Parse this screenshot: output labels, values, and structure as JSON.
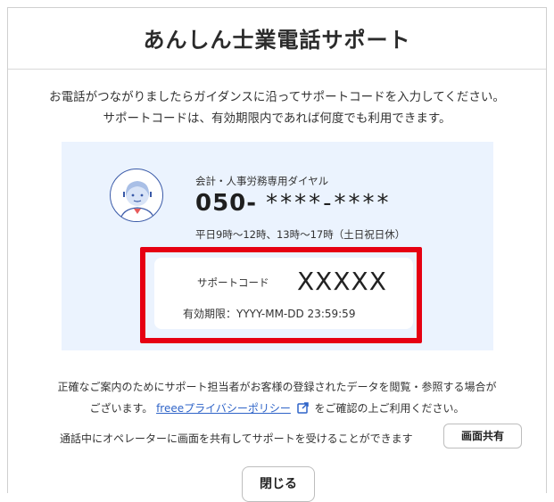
{
  "dialog": {
    "title": "あんしん士業電話サポート",
    "description_line1": "お電話がつながりましたらガイダンスに沿ってサポートコードを入力してください。",
    "description_line2": "サポートコードは、有効期限内であれば何度でも利用できます。"
  },
  "dial": {
    "label": "会計・人事労務専用ダイヤル",
    "number_prefix": "050-",
    "number_masked": "****-****",
    "hours": "平日9時〜12時、13時〜17時（土日祝日休）"
  },
  "code": {
    "label": "サポートコード",
    "value": "XXXXX",
    "expiry": "有効期限：YYYY-MM-DD 23:59:59"
  },
  "notice": {
    "line1": "正確なご案内のためにサポート担当者がお客様の登録されたデータを閲覧・参照する場合が",
    "line2_prefix": "ございます。",
    "link_text": "freeeプライバシーポリシー",
    "line2_suffix": "をご確認の上ご利用ください。"
  },
  "share": {
    "text": "通話中にオペレーターに画面を共有してサポートを受けることができます",
    "button_label": "画面共有"
  },
  "footer": {
    "close_label": "閉じる"
  },
  "icons": {
    "avatar": "operator-avatar-icon",
    "external_link": "external-link-icon"
  },
  "colors": {
    "highlight": "#e60012",
    "panel_bg": "#ebf3fe",
    "link": "#2f64c8"
  }
}
